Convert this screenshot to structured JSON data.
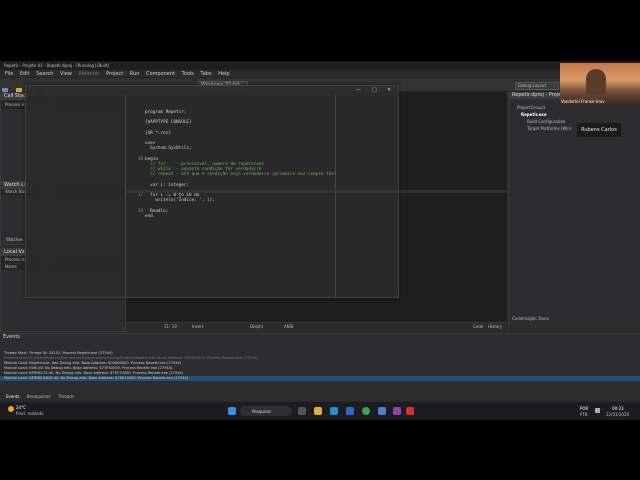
{
  "ide": {
    "title": "Repetir - Projeto 01 - Repetir.dproj - [Running] [Built]",
    "menu": [
      "File",
      "Edit",
      "Search",
      "View",
      "Refactor",
      "Project",
      "Run",
      "Component",
      "Tools",
      "Tabs",
      "Help"
    ],
    "platform": "Windows 32-bit",
    "layout_label": "Debug Layout",
    "left_panels": {
      "call_stack": {
        "title": "Call Stack",
        "status": "Process is not accessible"
      },
      "watch_list": {
        "title": "Watch List",
        "col_name": "Watch Name",
        "col_value": "Value",
        "footer": "Watches"
      },
      "local_vars": {
        "title": "Local Variables",
        "status": "Process is not accessible",
        "col_name": "Name",
        "col_value": "Value"
      }
    },
    "editor": {
      "search_type": "Search for a type",
      "search_method": "Search for a method",
      "code_lines": [
        {
          "ln": "",
          "text": "program Repetir;"
        },
        {
          "ln": "",
          "text": ""
        },
        {
          "ln": "",
          "text": "{$APPTYPE CONSOLE}"
        },
        {
          "ln": "",
          "text": ""
        },
        {
          "ln": "",
          "text": "{$R *.res}"
        },
        {
          "ln": "",
          "text": ""
        },
        {
          "ln": "",
          "text": "uses"
        },
        {
          "ln": "",
          "text": "  System.SysUtils;"
        },
        {
          "ln": "",
          "text": ""
        },
        {
          "ln": "10",
          "text": "begin"
        },
        {
          "ln": "",
          "text": "  // for    - previsivel, numero de repeticoes"
        },
        {
          "ln": "",
          "text": "  // while  - equanto condição for verdadeira"
        },
        {
          "ln": "",
          "text": "  // repeat - até que a condição seja verdadeira (primeiro vez sempre faz)"
        },
        {
          "ln": "",
          "text": ""
        },
        {
          "ln": "",
          "text": "  var i: integer;"
        },
        {
          "ln": "",
          "text": ""
        },
        {
          "ln": "17",
          "text": "  for i := 0 to 10 do"
        },
        {
          "ln": "",
          "text": "    writeln('Índice: ', i);"
        },
        {
          "ln": "",
          "text": ""
        },
        {
          "ln": "20",
          "text": "  Readln;"
        },
        {
          "ln": "",
          "text": "end."
        }
      ],
      "status": {
        "position": "11: 19",
        "mode": "Insert",
        "language": "Delphi",
        "encoding": "ANSI",
        "tab_code": "Code",
        "tab_history": "History"
      }
    },
    "right_panel": {
      "title": "Repetir.dproj - Project...",
      "tree": [
        "ProjectGroup1",
        "Repetir.exe",
        "Build Configuration",
        "Target Platforms (Win)"
      ],
      "footer": "CodeInsight: Done"
    },
    "events": {
      "title": "Events",
      "lines": [
        "Thread Start: Thread ID: 24252. Process Repetir.exe (27544)",
        "Process Start: C:\\Users\\Rubens\\Documents\\Embarcadero\\Studio\\Projects\\Repetir.exe. Base Address: $00400000. Process Repetir.exe (27544)",
        "Module Load: Repetir.exe. Has Debug Info. Base Address: $00400000. Process Repetir.exe (27544)",
        "Module Load: ntdll.dll. No Debug Info. Base Address: $77F80000. Process Repetir.exe (27544)",
        "Module Load: KERNEL32.dll. No Debug Info. Base Address: $75E70000. Process Repetir.exe (27544)",
        "Module Load: KERNELBASE.dll. No Debug Info. Base Address: $76670000. Process Repetir.exe (27544)"
      ],
      "tabs": [
        "Events",
        "Breakpoints",
        "Threads"
      ]
    }
  },
  "webcam": {
    "name": "Vanderlei Franke Univ"
  },
  "participant": {
    "name": "Rubens Carlos"
  },
  "floating_window": {
    "min": "—",
    "max": "□",
    "close": "✕"
  },
  "taskbar": {
    "weather_temp": "24°C",
    "weather_desc": "Pred. nublado",
    "search": "Pesquisar",
    "lang1": "POR",
    "lang2": "PTB",
    "time": "09:23",
    "date": "22/03/2026"
  },
  "colors": {
    "editor_bg": "#1e1e1e",
    "comment": "#7fa86a",
    "selection": "#264f78",
    "taskbar": "#1c1c22"
  }
}
